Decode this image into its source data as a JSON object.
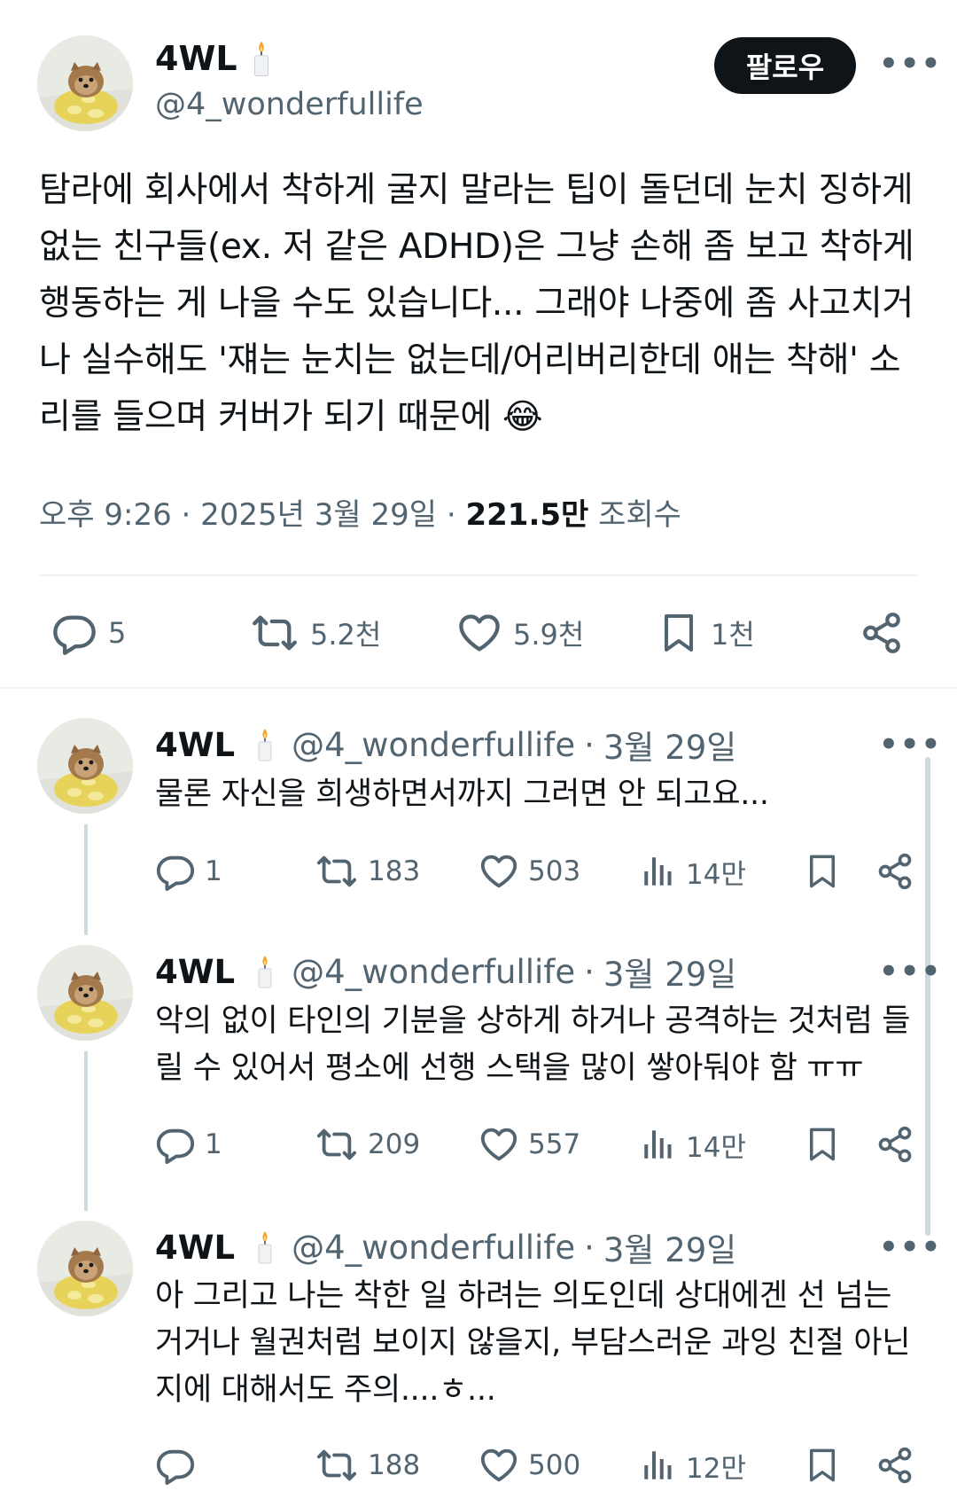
{
  "main_post": {
    "display_name": "4WL",
    "handle": "@4_wonderfullife",
    "follow_label": "팔로우",
    "more_label": "•••",
    "text": "탐라에 회사에서 착하게 굴지 말라는 팁이 돌던데 눈치 징하게 없는 친구들(ex. 저 같은 ADHD)은 그냥 손해 좀 보고 착하게 행동하는 게 나을 수도 있습니다... 그래야 나중에 좀 사고치거나 실수해도 '쟤는 눈치는 없는데/어리버리한데 애는 착해' 소리를 들으며 커버가 되기 때문에 😂",
    "time": "오후 9:26",
    "date": "2025년 3월 29일",
    "views_count": "221.5만",
    "views_label": "조회수",
    "stats": {
      "replies": "5",
      "reposts": "5.2천",
      "likes": "5.9천",
      "bookmarks": "1천"
    }
  },
  "replies": [
    {
      "display_name": "4WL",
      "handle": "@4_wonderfullife",
      "date": "3월 29일",
      "text": "물론 자신을 희생하면서까지 그러면 안 되고요...",
      "replies": "1",
      "reposts": "183",
      "likes": "503",
      "views": "14만"
    },
    {
      "display_name": "4WL",
      "handle": "@4_wonderfullife",
      "date": "3월 29일",
      "text": "악의 없이 타인의 기분을 상하게 하거나 공격하는 것처럼 들릴 수 있어서 평소에 선행 스택을 많이 쌓아둬야 함 ㅠㅠ",
      "replies": "1",
      "reposts": "209",
      "likes": "557",
      "views": "14만"
    },
    {
      "display_name": "4WL",
      "handle": "@4_wonderfullife",
      "date": "3월 29일",
      "text": "아 그리고 나는 착한 일 하려는 의도인데 상대에겐 선 넘는 거거나 월권처럼 보이지 않을지, 부담스러운 과잉 친절 아닌지에 대해서도 주의....ㅎ...",
      "replies": "",
      "reposts": "188",
      "likes": "500",
      "views": "12만"
    }
  ],
  "separator": "·",
  "icons": {
    "reply": "reply-icon",
    "repost": "repost-icon",
    "like": "heart-icon",
    "bookmark": "bookmark-icon",
    "share": "share-icon",
    "views": "analytics-icon",
    "candle": "candle-emoji-icon"
  },
  "colors": {
    "text": "#0f1419",
    "muted": "#536471",
    "divider": "#eff3f4",
    "follow_bg": "#0f1419"
  }
}
